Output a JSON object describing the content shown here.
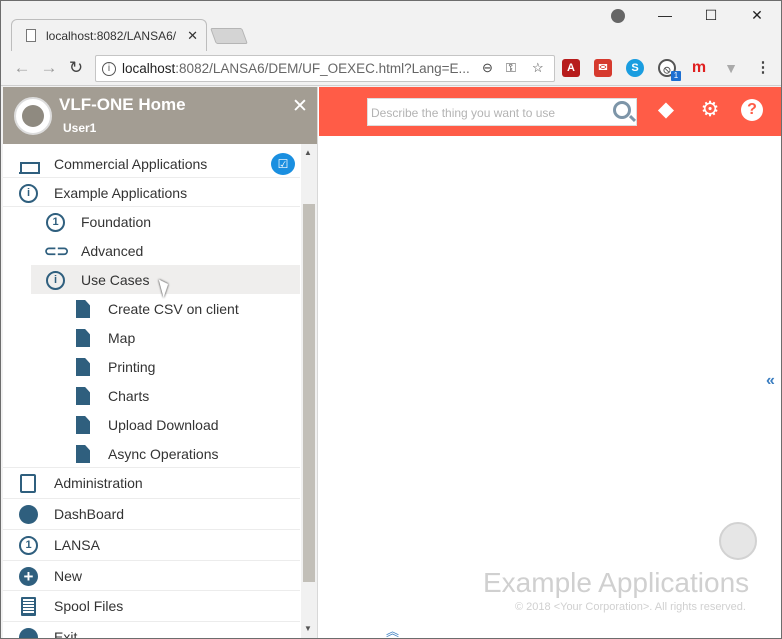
{
  "browser": {
    "tab_title": "localhost:8082/LANSA6/",
    "tab_close": "✕",
    "window_controls": {
      "minimize": "—",
      "maximize": "☐",
      "close": "✕"
    },
    "url_host": "localhost",
    "url_rest": ":8082/LANSA6/DEM/UF_OEXEC.html?Lang=E...",
    "extension_badge": "1"
  },
  "sidebar": {
    "title": "VLF-ONE Home",
    "user": "User1",
    "close": "✕",
    "items": [
      {
        "label": "Commercial Applications",
        "icon": "factory-icon",
        "level": 0
      },
      {
        "label": "Example Applications",
        "icon": "info-icon",
        "level": 0
      },
      {
        "label": "Foundation",
        "icon": "one-icon",
        "level": 1
      },
      {
        "label": "Advanced",
        "icon": "link-icon",
        "level": 1
      },
      {
        "label": "Use Cases",
        "icon": "info-icon",
        "level": 1
      },
      {
        "label": "Create CSV on client",
        "icon": "document-icon",
        "level": 2
      },
      {
        "label": "Map",
        "icon": "document-icon",
        "level": 2
      },
      {
        "label": "Printing",
        "icon": "document-icon",
        "level": 2
      },
      {
        "label": "Charts",
        "icon": "document-icon",
        "level": 2
      },
      {
        "label": "Upload Download",
        "icon": "document-icon",
        "level": 2
      },
      {
        "label": "Async Operations",
        "icon": "document-icon",
        "level": 2
      },
      {
        "label": "Administration",
        "icon": "clipboard-icon",
        "level": 0
      },
      {
        "label": "DashBoard",
        "icon": "globe-icon",
        "level": 0
      },
      {
        "label": "LANSA",
        "icon": "one-icon",
        "level": 0
      },
      {
        "label": "New",
        "icon": "plus-icon",
        "level": 0
      },
      {
        "label": "Spool Files",
        "icon": "list-icon",
        "level": 0
      },
      {
        "label": "Exit",
        "icon": "exit-icon",
        "level": 0
      }
    ]
  },
  "topbar": {
    "search_placeholder": "Describe the thing you want to use"
  },
  "main": {
    "brand_title": "Example Applications",
    "copyright": "© 2018 <Your Corporation>. All rights reserved."
  },
  "colors": {
    "topbar": "#ff5c47",
    "sidebar_header": "#a39d93",
    "icon": "#2f5f7e",
    "badge": "#1a8fe0"
  }
}
